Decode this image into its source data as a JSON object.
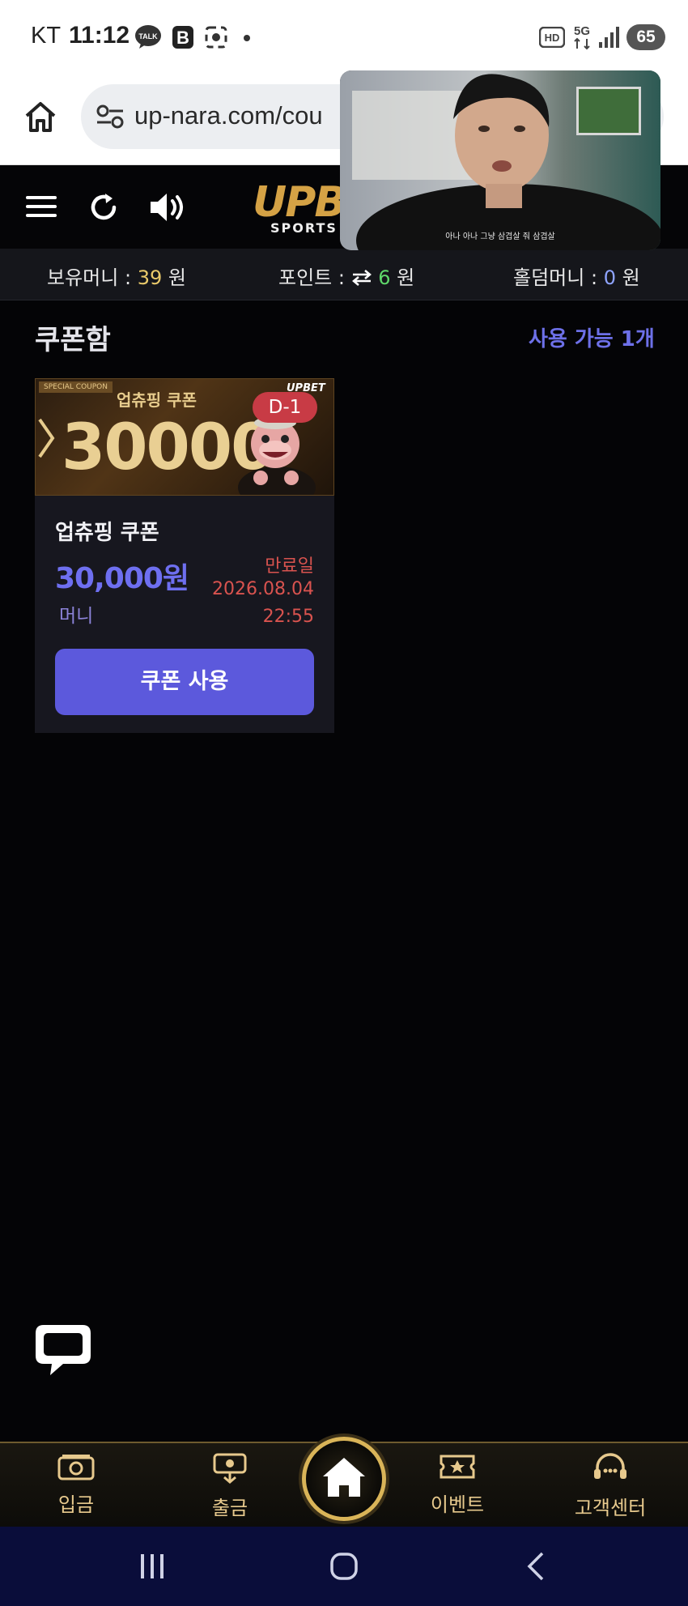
{
  "status_bar": {
    "carrier": "KT",
    "time": "11:12",
    "battery": "65",
    "icons": [
      "talk-icon",
      "b-app-icon",
      "screenshot-icon",
      "hd-icon",
      "5g-icon",
      "signal-icon"
    ]
  },
  "browser": {
    "url": "up-nara.com/cou",
    "home_icon": "home-icon",
    "site_info_icon": "site-settings-icon"
  },
  "pip_video": {
    "subtitle": "아나 아나 그냥 삼겹살 줘 삼겹살"
  },
  "site_header": {
    "logo_main": "UPB",
    "logo_sub": "SPORTS",
    "icons": [
      "menu-icon",
      "refresh-icon",
      "sound-icon"
    ]
  },
  "balance": {
    "money_label": "보유머니 :",
    "money_value": "39",
    "money_unit": "원",
    "points_label": "포인트 :",
    "points_value": "6",
    "points_unit": "원",
    "holdem_label": "홀덤머니 :",
    "holdem_value": "0",
    "holdem_unit": "원"
  },
  "page": {
    "title": "쿠폰함",
    "available": "사용 가능 1개"
  },
  "coupon": {
    "banner_tag": "SPECIAL COUPON",
    "banner_title": "업츄핑 쿠폰",
    "banner_amount": "30000",
    "banner_brand": "UPBET",
    "dday": "D-1",
    "name": "업츄핑 쿠폰",
    "value": "30,000원",
    "type": "머니",
    "expiry_label": "만료일",
    "expiry_date": "2026.08.04",
    "expiry_time": "22:55",
    "use_button": "쿠폰 사용"
  },
  "bottom_nav": {
    "items": [
      {
        "label": "입금",
        "icon": "deposit-icon"
      },
      {
        "label": "출금",
        "icon": "withdraw-icon"
      },
      {
        "label": "이벤트",
        "icon": "event-ticket-icon"
      },
      {
        "label": "고객센터",
        "icon": "support-headset-icon"
      }
    ],
    "home_icon": "home-icon"
  },
  "colors": {
    "accent": "#5c59dc",
    "gold": "#d9b458",
    "expiry": "#d9534f",
    "background": "#040406"
  }
}
